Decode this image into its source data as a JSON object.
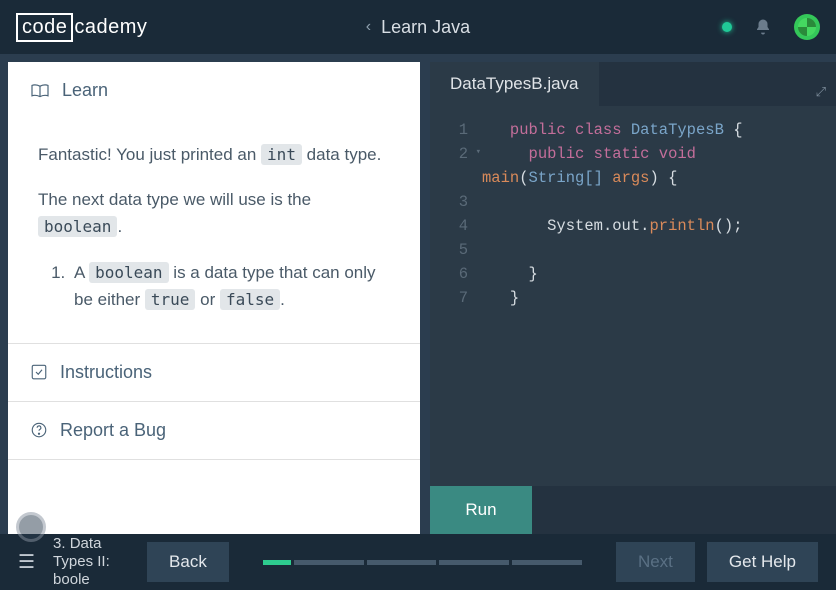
{
  "header": {
    "logo_part1": "code",
    "logo_part2": "cademy",
    "title": "Learn Java"
  },
  "learn": {
    "header": "Learn",
    "intro_before": "Fantastic! You just printed an ",
    "intro_code": "int",
    "intro_after": " data type.",
    "next_before": "The next data type we will use is the ",
    "next_code": "boolean",
    "next_after": ".",
    "list_item_p1": "A ",
    "list_item_code1": "boolean",
    "list_item_p2": " is a data type that can only be either ",
    "list_item_code2": "true",
    "list_item_p3": " or ",
    "list_item_code3": "false",
    "list_item_p4": "."
  },
  "instructions_header": "Instructions",
  "report_bug_header": "Report a Bug",
  "editor": {
    "filename": "DataTypesB.java",
    "lines": {
      "l1": "1",
      "l2": "2",
      "l3": "3",
      "l4": "4",
      "l5": "5",
      "l6": "6",
      "l7": "7"
    },
    "code": {
      "public": "public",
      "class": "class",
      "classname": "DataTypesB",
      "static": "static",
      "void": "void",
      "main": "main",
      "stringarr": "String[]",
      "args": "args",
      "system": "System",
      "out": "out",
      "println": "println",
      "obrace": "{",
      "cbrace": "}",
      "oparen": "(",
      "cparen": ")",
      "semi": ";",
      "dot": "."
    }
  },
  "run_label": "Run",
  "footer": {
    "lesson_title": "3. Data Types II: boole",
    "back": "Back",
    "next": "Next",
    "get_help": "Get Help"
  }
}
